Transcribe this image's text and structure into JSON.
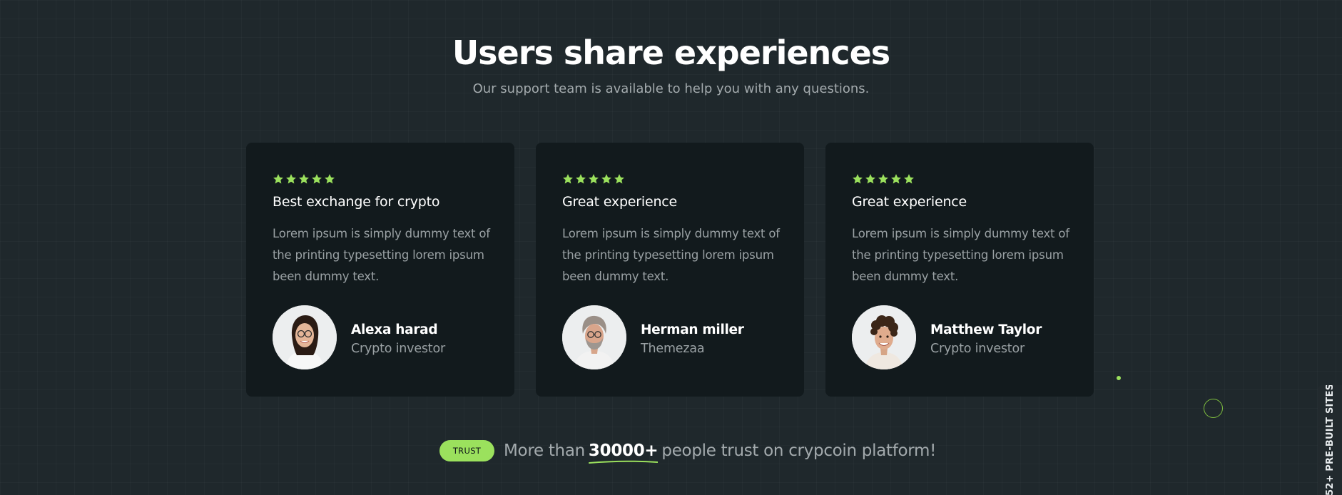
{
  "section": {
    "title": "Users share experiences",
    "subtitle": "Our support team is available to help you with any questions."
  },
  "rating_color": "#9be15d",
  "testimonials": [
    {
      "rating": 5,
      "title": "Best exchange for crypto",
      "text": "Lorem ipsum is simply dummy text of the printing typesetting lorem ipsum been dummy text.",
      "name": "Alexa harad",
      "role": "Crypto investor",
      "avatar": "woman-with-glasses-portrait"
    },
    {
      "rating": 5,
      "title": "Great experience",
      "text": "Lorem ipsum is simply dummy text of the printing typesetting lorem ipsum been dummy text.",
      "name": "Herman miller",
      "role": "Themezaa",
      "avatar": "older-man-with-glasses-portrait"
    },
    {
      "rating": 5,
      "title": "Great experience",
      "text": "Lorem ipsum is simply dummy text of the printing typesetting lorem ipsum been dummy text.",
      "name": "Matthew Taylor",
      "role": "Crypto investor",
      "avatar": "curly-haired-man-portrait"
    }
  ],
  "trust": {
    "badge": "TRUST",
    "prefix": "More than",
    "count": "30000+",
    "suffix": "people trust on crypcoin platform!"
  },
  "side_tab": {
    "label": "52+ PRE-BUILT SITES"
  },
  "colors": {
    "background": "#1f282c",
    "card": "#121a1d",
    "accent": "#9be15d",
    "muted_text": "#9aa1a4"
  }
}
